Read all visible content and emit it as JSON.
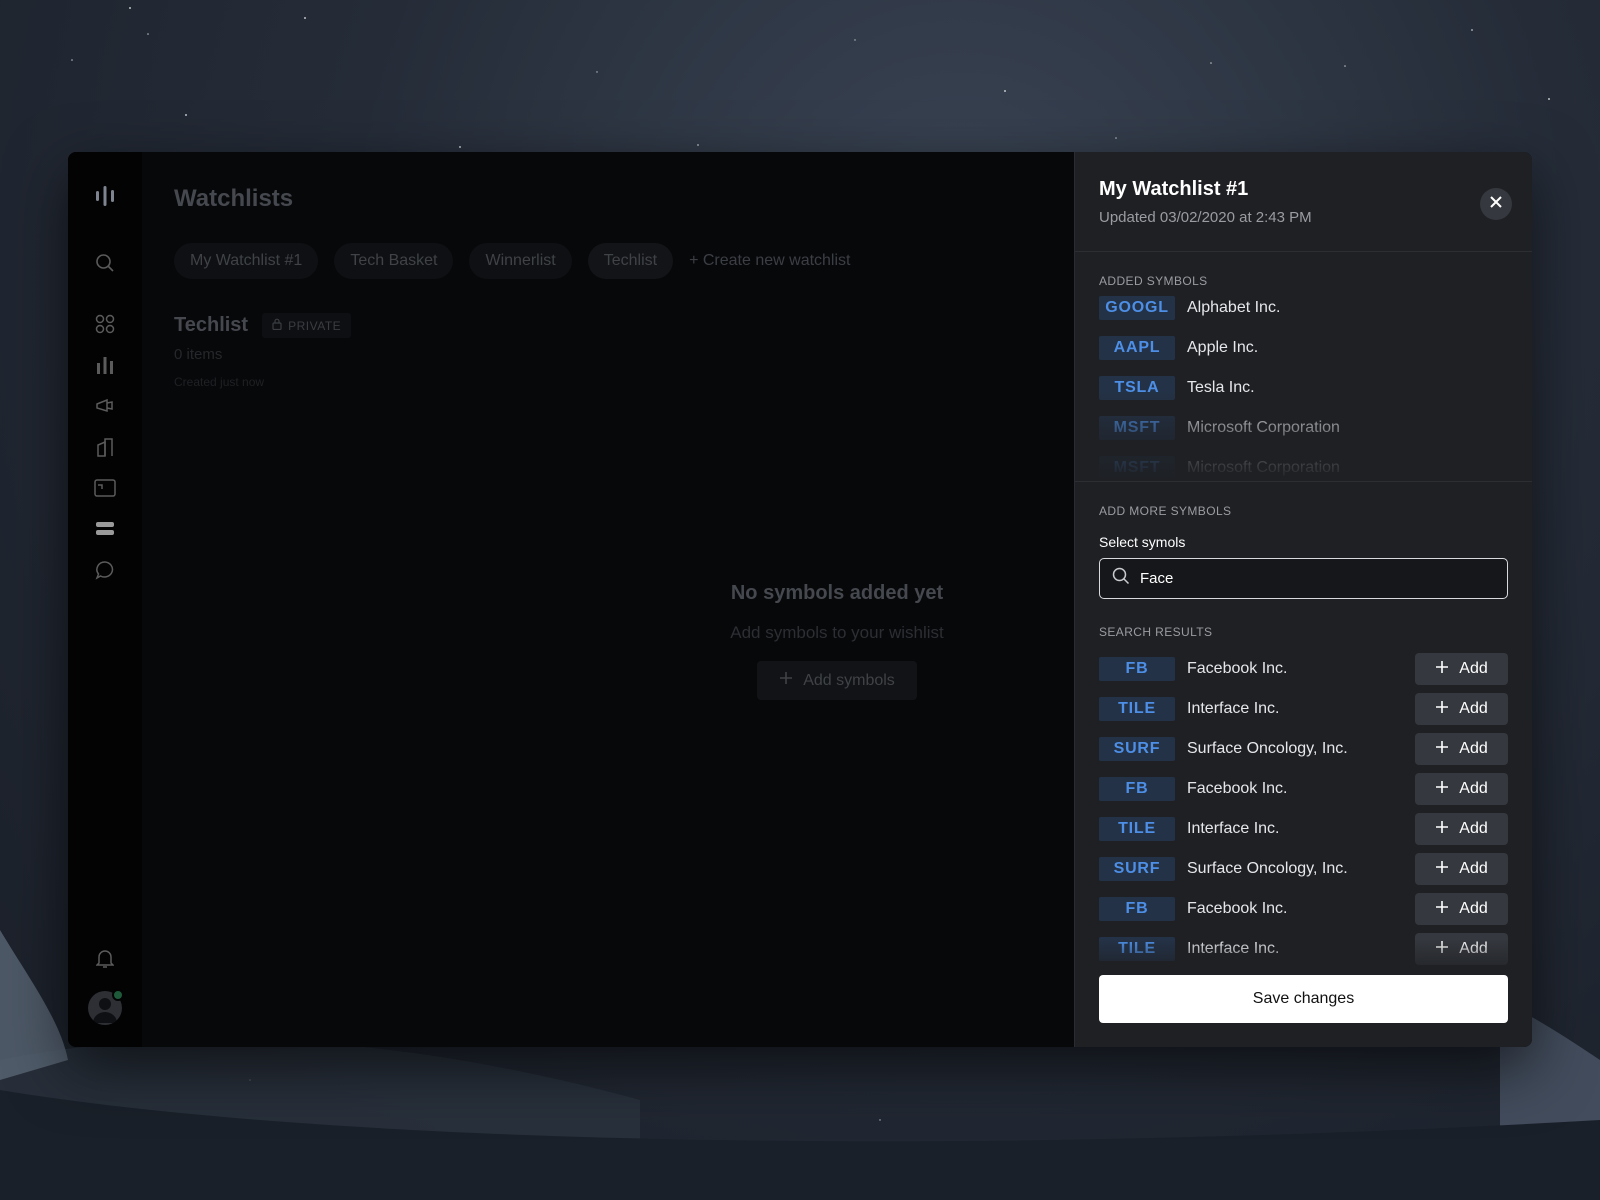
{
  "app": {
    "page_title": "Watchlists",
    "tabs": [
      {
        "label": "My Watchlist #1"
      },
      {
        "label": "Tech Basket"
      },
      {
        "label": "Winnerlist"
      },
      {
        "label": "Techlist"
      }
    ],
    "create_link": "+ Create new watchlist",
    "list": {
      "title": "Techlist",
      "badge": "PRIVATE",
      "items_count": "0 items",
      "created": "Created just now"
    },
    "empty": {
      "title": "No symbols added yet",
      "subtitle": "Add symbols to your wishlist",
      "button": "Add symbols"
    }
  },
  "panel": {
    "title": "My Watchlist #1",
    "updated": "Updated 03/02/2020 at 2:43 PM",
    "added_label": "ADDED SYMBOLS",
    "added": [
      {
        "ticker": "GOOGL",
        "name": "Alphabet Inc."
      },
      {
        "ticker": "AAPL",
        "name": "Apple Inc."
      },
      {
        "ticker": "TSLA",
        "name": "Tesla Inc."
      },
      {
        "ticker": "MSFT",
        "name": "Microsoft Corporation"
      },
      {
        "ticker": "MSFT",
        "name": "Microsoft Corporation"
      }
    ],
    "add_more_label": "ADD MORE SYMBOLS",
    "field_label": "Select symols",
    "search_value": "Face",
    "results_label": "SEARCH RESULTS",
    "add_label": "Add",
    "results": [
      {
        "ticker": "FB",
        "name": "Facebook Inc."
      },
      {
        "ticker": "TILE",
        "name": "Interface Inc."
      },
      {
        "ticker": "SURF",
        "name": "Surface Oncology, Inc."
      },
      {
        "ticker": "FB",
        "name": "Facebook Inc."
      },
      {
        "ticker": "TILE",
        "name": "Interface Inc."
      },
      {
        "ticker": "SURF",
        "name": "Surface Oncology, Inc."
      },
      {
        "ticker": "FB",
        "name": "Facebook Inc."
      },
      {
        "ticker": "TILE",
        "name": "Interface Inc."
      }
    ],
    "save_label": "Save changes"
  },
  "colors": {
    "accent": "#4d8fe6",
    "ticker_bg": "#243247",
    "panel_bg": "#1e2024",
    "online": "#1e5a3a"
  },
  "icons": {
    "rail": [
      "logo-icon",
      "search-icon",
      "grid-icon",
      "bar-chart-icon",
      "megaphone-icon",
      "buildings-icon",
      "card-icon",
      "stack-icon",
      "chat-icon",
      "bell-icon"
    ]
  }
}
